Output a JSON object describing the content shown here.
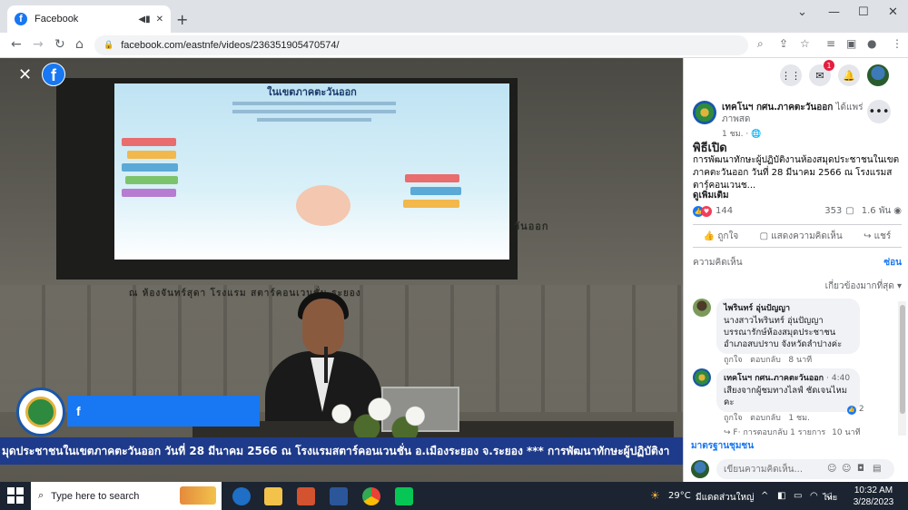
{
  "browser": {
    "tab_title": "Facebook",
    "url": "facebook.com/eastnfe/videos/236351905470574/"
  },
  "video": {
    "slide_title": "ในเขตภาคตะวันออก",
    "wall_text_right": "วันออก",
    "wall_text_bottom": "ณ ห้องจันทร์สุดา โรงแรม สตาร์คอนเวนชั่น ระยอง",
    "bluebar_label": "f",
    "ticker": "มุดประชาชนในเขตภาคตะวันออก วันที่ 28 มีนาคม 2566 ณ โรงแรมสตาร์คอนเวนชั่น อ.เมืองระยอง จ.ระยอง   *** การพัฒนาทักษะผู้ปฏิบัติงา"
  },
  "panel": {
    "messenger_badge": "1",
    "page_name": "เทคโนฯ กศน.ภาคตะวันออก",
    "page_action": "ได้แพร่ภาพสด",
    "post_meta": "1 ชม. · 🌐",
    "post_title": "พิธีเปิด",
    "post_desc": "การพัฒนาทักษะผู้ปฏิบัติงานห้องสมุดประชาชนในเขตภาคตะวันออก วันที่ 28 มีนาคม 2566 ณ โรงแรมสตาร์คอนเวนช...",
    "see_more": "ดูเพิ่มเติม",
    "reactions_count": "144",
    "comments_count": "353",
    "views_count": "1.6 พัน",
    "action_like": "ถูกใจ",
    "action_comment": "แสดงความคิดเห็น",
    "action_share": "แชร์",
    "comments_tab": "ความคิดเห็น",
    "hide_tab": "ซ่อน",
    "sort_label": "เกี่ยวข้องมากที่สุด",
    "comments": [
      {
        "author": "ไพรินทร์ อุ่นปัญญา",
        "text": "นางสาวไพรินทร์ อุ่นปัญญา บรรณารักษ์ห้องสมุดประชาชนอำเภอสบปราบ จังหวัดลำปางค่ะ",
        "like": "ถูกใจ",
        "reply": "ตอบกลับ",
        "time": "8 นาที"
      },
      {
        "author": "เทคโนฯ กศน.ภาคตะวันออก",
        "time_inline": "· 4:40",
        "text": "เสียงจากผู้ชมทางไลฟ์ ชัดเจนไหมคะ",
        "like": "ถูกใจ",
        "reply": "ตอบกลับ",
        "time": "1 ชม.",
        "reaction_count": "2"
      }
    ],
    "reply_summary": "F· การตอบกลับ 1 รายการ",
    "reply_time": "10 นาที",
    "standard_link": "มาตรฐานชุมชน",
    "compose_placeholder": "เขียนความคิดเห็น..."
  },
  "taskbar": {
    "search_placeholder": "Type here to search",
    "weather": "29°C",
    "weather_desc": "มีแดดส่วนใหญ่",
    "lang": "ไทย",
    "time": "10:32 AM",
    "date": "3/28/2023"
  },
  "colors": {
    "facebook_blue": "#1877f2",
    "ticker_bg": "#1e3a8a",
    "taskbar_bg": "#1b2430"
  }
}
